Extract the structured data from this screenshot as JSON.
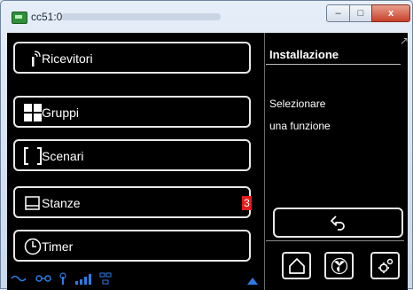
{
  "window": {
    "title": "cc51:0",
    "min_label": "–",
    "max_label": "□",
    "close_label": "x"
  },
  "menu": [
    {
      "id": "ricevitori",
      "label": "Ricevitori",
      "icon": "antenna-icon"
    },
    {
      "id": "gruppi",
      "label": "Gruppi",
      "icon": "grid-icon"
    },
    {
      "id": "scenari",
      "label": "Scenari",
      "icon": "brackets-icon"
    },
    {
      "id": "stanze",
      "label": "Stanze",
      "icon": "room-icon",
      "badge": "3"
    },
    {
      "id": "timer",
      "label": "Timer",
      "icon": "clock-icon"
    }
  ],
  "panel": {
    "title": "Installazione",
    "message_line1": "Selezionare",
    "message_line2": "una funzione"
  },
  "colors": {
    "background": "#000000",
    "text": "#ffffff",
    "badge": "#e21b1b",
    "status_icons": "#2c7be5"
  },
  "toolbar": [
    "home-icon",
    "fan-icon",
    "settings-icon"
  ]
}
